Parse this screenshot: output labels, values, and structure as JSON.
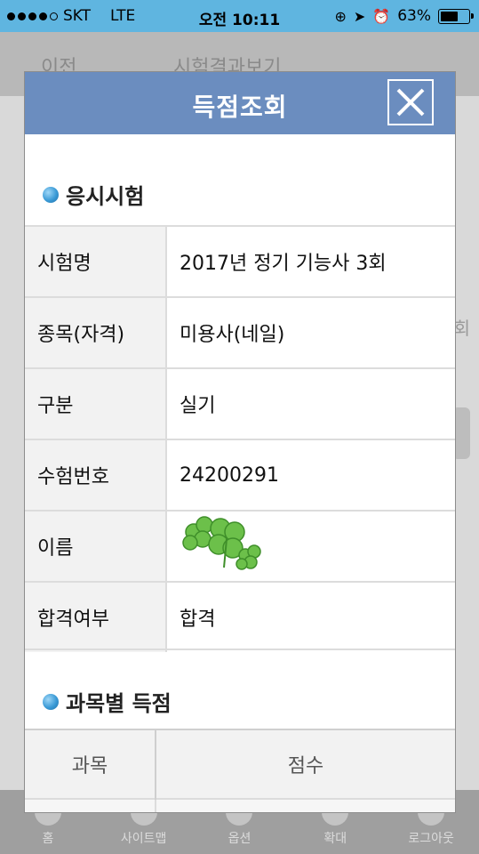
{
  "status_bar": {
    "carrier": "SKT",
    "network": "LTE",
    "time": "오전 10:11",
    "battery_percent": "63%"
  },
  "background": {
    "back_label": "이전",
    "title": "시험결과보기",
    "side_text": "회"
  },
  "bottom_nav": {
    "items": [
      "홈",
      "사이트맵",
      "옵션",
      "확대",
      "로그아웃"
    ]
  },
  "modal": {
    "title": "득점조회",
    "section1_title": "응시시험",
    "rows": [
      {
        "label": "시험명",
        "value": "2017년 정기 기능사 3회"
      },
      {
        "label": "종목(자격)",
        "value": "미용사(네일)"
      },
      {
        "label": "구분",
        "value": "실기"
      },
      {
        "label": "수험번호",
        "value": "24200291"
      },
      {
        "label": "이름",
        "value": ""
      },
      {
        "label": "합격여부",
        "value": "합격"
      }
    ],
    "section2_title": "과목별 득점",
    "score_headers": [
      "과목",
      "점수"
    ]
  },
  "colors": {
    "status_bar": "#5fb5e0",
    "modal_header": "#6b8dbf",
    "clover": "#6cc04a"
  }
}
